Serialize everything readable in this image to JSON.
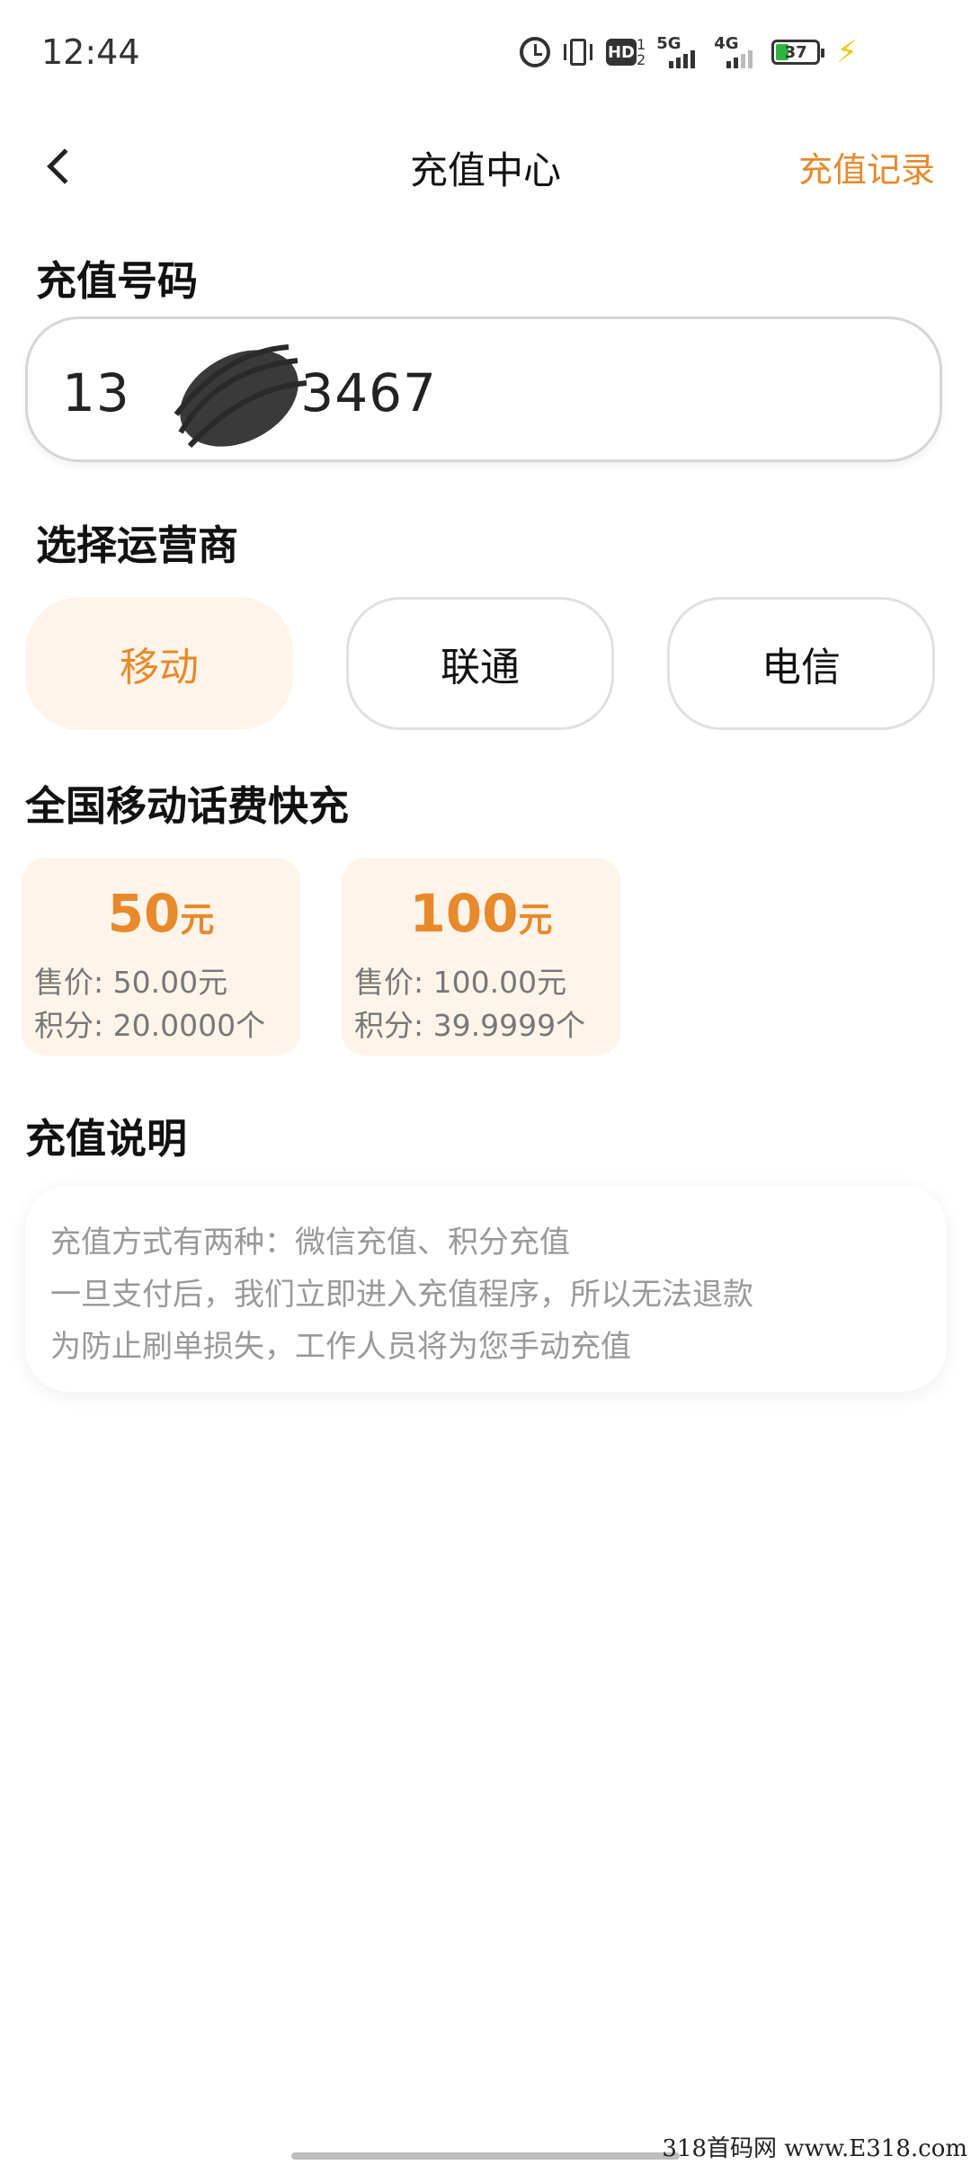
{
  "status_bar": {
    "time": "12:44",
    "hd_label": "HD",
    "hd_sub_top": "1",
    "hd_sub_bottom": "2",
    "network1": "5G",
    "network2": "4G",
    "battery": "37",
    "icons": [
      "alarm-icon",
      "vibrate-icon",
      "hd-icon",
      "signal-5g-icon",
      "signal-4g-icon",
      "battery-icon",
      "charging-icon"
    ]
  },
  "nav": {
    "title": "充值中心",
    "action": "充值记录"
  },
  "phone_section": {
    "title": "充值号码",
    "value": "13     3467"
  },
  "carrier_section": {
    "title": "选择运营商",
    "carriers": [
      {
        "label": "移动",
        "selected": true
      },
      {
        "label": "联通",
        "selected": false
      },
      {
        "label": "电信",
        "selected": false
      }
    ]
  },
  "products_section": {
    "title": "全国移动话费快充",
    "items": [
      {
        "amount": "50",
        "unit": "元",
        "price": "售价: 50.00元",
        "points": "积分: 20.0000个"
      },
      {
        "amount": "100",
        "unit": "元",
        "price": "售价: 100.00元",
        "points": "积分: 39.9999个"
      }
    ]
  },
  "description_section": {
    "title": "充值说明",
    "lines": [
      "充值方式有两种：微信充值、积分充值",
      "一旦支付后，我们立即进入充值程序，所以无法退款",
      "为防止刷单损失，工作人员将为您手动充值"
    ]
  },
  "colors": {
    "accent": "#e8892b",
    "selected_bg": "#fff4e9",
    "muted_text": "#999999"
  },
  "watermark": "318首码网 www.E318.com"
}
